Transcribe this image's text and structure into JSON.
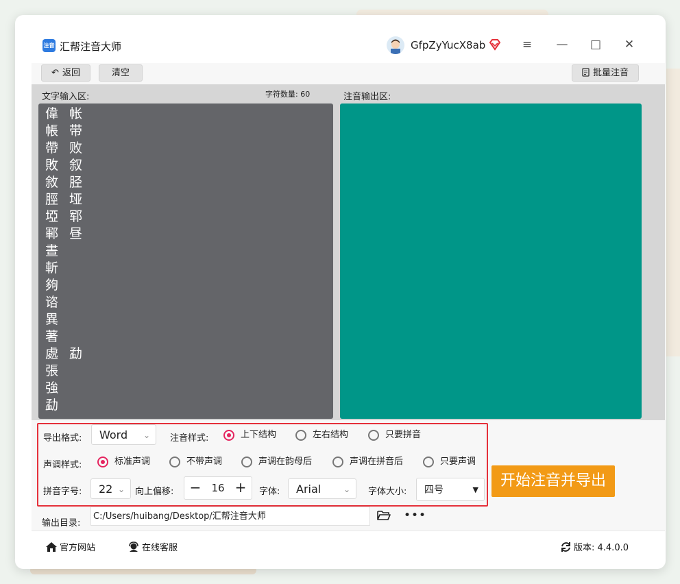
{
  "app": {
    "title": "汇帮注音大师",
    "icon_text": "注音"
  },
  "user": {
    "name": "GfpZyYucX8ab"
  },
  "window_controls": {
    "menu": "≡",
    "minimize": "—",
    "maximize": "□",
    "close": "✕"
  },
  "toolbar": {
    "back_label": "返回",
    "clear_label": "清空",
    "batch_label": "批量注音"
  },
  "input_panel": {
    "label": "文字输入区:",
    "count_label": "字符数量: 60",
    "lines": [
      "偉 帐",
      "帳 带",
      "帶 败",
      "敗 叙",
      "敘 胫",
      "脛 垭",
      "埡 郓",
      "鄆 昼",
      "晝",
      "斬",
      "夠",
      "谘",
      "異",
      "著",
      "處 勐",
      "張",
      "強",
      "勐"
    ]
  },
  "output_panel": {
    "label": "注音输出区:"
  },
  "options": {
    "export_format_label": "导出格式:",
    "export_format_value": "Word",
    "annotation_style_label": "注音样式:",
    "annotation_styles": [
      "上下结构",
      "左右结构",
      "只要拼音"
    ],
    "annotation_style_selected": 0,
    "tone_style_label": "声调样式:",
    "tone_styles": [
      "标准声调",
      "不带声调",
      "声调在韵母后",
      "声调在拼音后",
      "只要声调"
    ],
    "tone_style_selected": 0,
    "pinyin_size_label": "拼音字号:",
    "pinyin_size_value": "22",
    "offset_label": "向上偏移:",
    "offset_value": "16",
    "font_label": "字体:",
    "font_value": "Arial",
    "font_size_label": "字体大小:",
    "font_size_value": "四号"
  },
  "start_button": "开始注音并导出",
  "output_dir": {
    "label": "输出目录:",
    "value": "C:/Users/huibang/Desktop/汇帮注音大师"
  },
  "footer": {
    "website": "官方网站",
    "support": "在线客服",
    "version": "版本: 4.4.0.0"
  },
  "colors": {
    "input_bg": "#646569",
    "output_bg": "#009688",
    "accent_pink": "#e5245f",
    "start_orange": "#f29a16",
    "highlight_red": "#e5303a"
  }
}
